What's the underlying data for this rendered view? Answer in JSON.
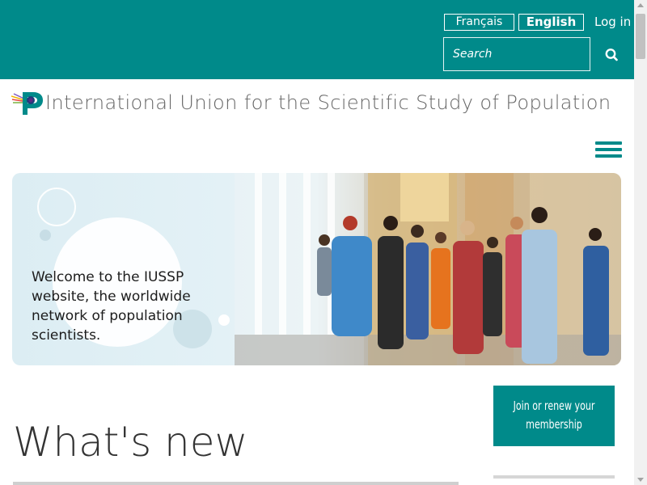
{
  "header": {
    "lang_fr": "Français",
    "lang_en": "English",
    "login": "Log in",
    "search_placeholder": "Search"
  },
  "org": {
    "name": "International Union for the Scientific Study of Population"
  },
  "hero": {
    "text": "Welcome to the IUSSP website, the worldwide network of population scientists."
  },
  "main": {
    "heading": "What's new"
  },
  "sidebar": {
    "join_label": "Join or renew your membership"
  },
  "colors": {
    "accent": "#008a8a"
  },
  "icons": {
    "search": "search-icon",
    "menu": "hamburger-menu-icon",
    "logo": "iussp-logo"
  }
}
